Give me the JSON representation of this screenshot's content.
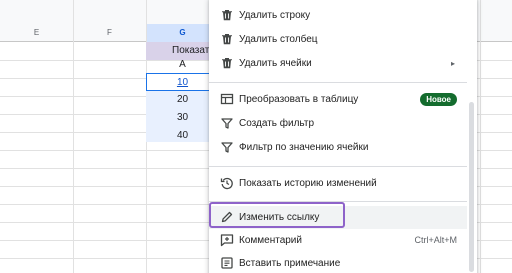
{
  "sheet": {
    "columns": [
      {
        "id": "e",
        "label": "E"
      },
      {
        "id": "f",
        "label": "F"
      },
      {
        "id": "g",
        "label": "G"
      }
    ],
    "cells": {
      "g_header": "Показат",
      "g_r1": "A",
      "g_r2": "10",
      "g_r3": "20",
      "g_r4": "30",
      "g_r5": "40"
    }
  },
  "menu": {
    "items": [
      {
        "id": "delete-row",
        "icon": "trash-icon",
        "label": "Удалить строку"
      },
      {
        "id": "delete-column",
        "icon": "trash-icon",
        "label": "Удалить столбец"
      },
      {
        "id": "delete-cells",
        "icon": "trash-icon",
        "label": "Удалить ячейки",
        "submenu_arrow": "▸"
      },
      {
        "id": "convert-to-table",
        "icon": "table-icon",
        "label": "Преобразовать в таблицу",
        "badge": "Новое"
      },
      {
        "id": "create-filter",
        "icon": "filter-icon",
        "label": "Создать фильтр"
      },
      {
        "id": "filter-by-value",
        "icon": "filter-icon",
        "label": "Фильтр по значению ячейки"
      },
      {
        "id": "show-edit-history",
        "icon": "history-icon",
        "label": "Показать историю изменений"
      },
      {
        "id": "edit-link",
        "icon": "pencil-icon",
        "label": "Изменить ссылку"
      },
      {
        "id": "comment",
        "icon": "add-comment-icon",
        "label": "Комментарий",
        "shortcut": "Ctrl+Alt+M"
      },
      {
        "id": "insert-note",
        "icon": "note-icon",
        "label": "Вставить примечание"
      }
    ]
  },
  "colors": {
    "highlight_border": "#8e63c9",
    "badge_bg": "#146c2e",
    "selection_bg": "#e8f0fe",
    "header_cell_bg": "#d9d2e9"
  }
}
